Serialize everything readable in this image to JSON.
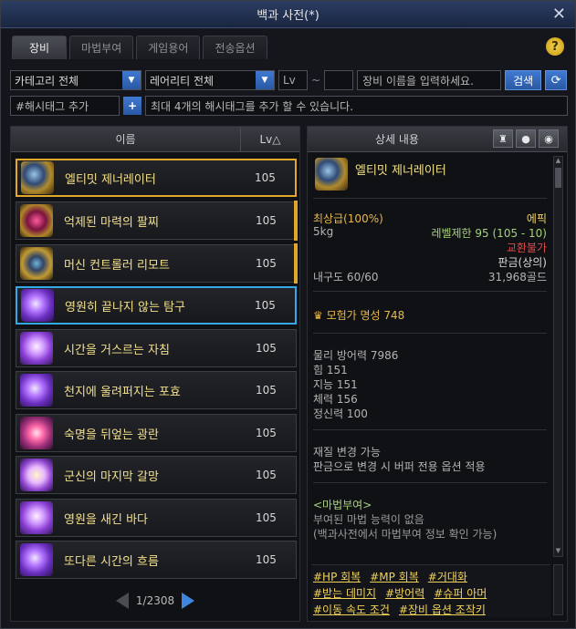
{
  "window": {
    "title": "백과 사전(*)",
    "close_glyph": "✕"
  },
  "tabs": [
    {
      "label": "장비",
      "active": true
    },
    {
      "label": "마법부여",
      "active": false
    },
    {
      "label": "게임용어",
      "active": false
    },
    {
      "label": "전송옵션",
      "active": false
    }
  ],
  "help_glyph": "?",
  "filters": {
    "category": "카테고리 전체",
    "rarity": "레어리티 전체",
    "lv_label": "Lv",
    "lv_sep": "~",
    "search_placeholder": "장비 이름을 입력하세요.",
    "search_label": "검색",
    "refresh_glyph": "⟳"
  },
  "hashtag": {
    "label": "#해시태그 추가",
    "plus": "+",
    "hint": "최대 4개의 해시태그를 추가 할 수 있습니다."
  },
  "list": {
    "col_name": "이름",
    "col_lv": "Lv△",
    "items": [
      {
        "name": "엘티밋 제너레이터",
        "lv": "105"
      },
      {
        "name": "억제된 마력의 팔찌",
        "lv": "105"
      },
      {
        "name": "머신 컨트롤러 리모트",
        "lv": "105"
      },
      {
        "name": "영원히 끝나지 않는 탐구",
        "lv": "105"
      },
      {
        "name": "시간을 거스르는 자침",
        "lv": "105"
      },
      {
        "name": "천지에 울려퍼지는 포효",
        "lv": "105"
      },
      {
        "name": "숙명을 뒤엎는 광란",
        "lv": "105"
      },
      {
        "name": "군신의 마지막 갈망",
        "lv": "105"
      },
      {
        "name": "영원을 새긴 바다",
        "lv": "105"
      },
      {
        "name": "또다른 시간의 흐름",
        "lv": "105"
      }
    ],
    "page": "1/2308"
  },
  "detail": {
    "header": "상세 내용",
    "name": "엘티밋 제너레이터",
    "grade": "최상급(100%)",
    "rarity": "에픽",
    "weight": "5kg",
    "level_limit": "레벨제한 95 (105 - 10)",
    "trade": "교환불가",
    "sell": "판금(상의)",
    "durability": "내구도 60/60",
    "price": "31,968골드",
    "fame": "모험가 명성 748",
    "stats": [
      "물리 방어력 7986",
      "힘 151",
      "지능 151",
      "체력 156",
      "정신력 100"
    ],
    "material_title": "재질 변경 가능",
    "material_desc": "판금으로 변경 시 버퍼 전용 옵션 적용",
    "enchant_title": "<마법부여>",
    "enchant_none": "부여된 마법 능력이 없음",
    "enchant_hint": "(백과사전에서 마법부여 정보 확인 가능)",
    "tags": [
      [
        "#HP 회복",
        "#MP 회복",
        "#거대화"
      ],
      [
        "#받는 데미지",
        "#방어력",
        "#슈퍼 아머"
      ],
      [
        "#이동 속도 조건",
        "#장비 옵션 조작키"
      ]
    ]
  }
}
